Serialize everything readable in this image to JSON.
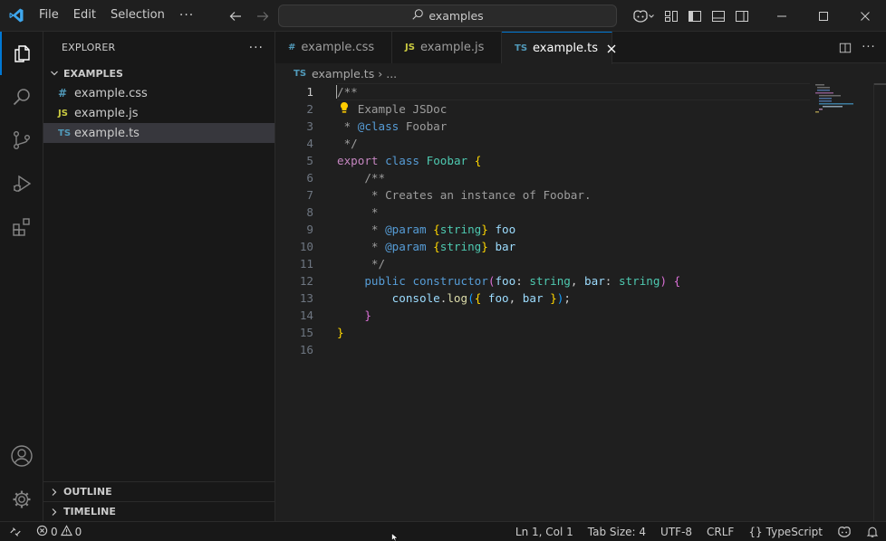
{
  "titlebar": {
    "menus": [
      "File",
      "Edit",
      "Selection"
    ],
    "more": "···",
    "search_text": "examples"
  },
  "sidebar": {
    "title": "EXPLORER",
    "more": "···",
    "folder": "EXAMPLES",
    "files": [
      {
        "name": "example.css",
        "icon": "#",
        "selected": false
      },
      {
        "name": "example.js",
        "icon": "JS",
        "selected": false
      },
      {
        "name": "example.ts",
        "icon": "TS",
        "selected": true
      }
    ],
    "outline": "OUTLINE",
    "timeline": "TIMELINE"
  },
  "tabs": [
    {
      "label": "example.css",
      "icon": "#",
      "active": false
    },
    {
      "label": "example.js",
      "icon": "JS",
      "active": false
    },
    {
      "label": "example.ts",
      "icon": "TS",
      "active": true
    }
  ],
  "breadcrumb": {
    "icon": "TS",
    "file": "example.ts",
    "sep": "›",
    "rest": "..."
  },
  "code": {
    "line_numbers": [
      "1",
      "2",
      "3",
      "4",
      "5",
      "6",
      "7",
      "8",
      "9",
      "10",
      "11",
      "12",
      "13",
      "14",
      "15",
      "16"
    ],
    "lines": [
      "/**",
      "   Example JSDoc",
      " * @class Foobar",
      " */",
      "export class Foobar {",
      "    /**",
      "     * Creates an instance of Foobar.",
      "     *",
      "     * @param {string} foo",
      "     * @param {string} bar",
      "     */",
      "    public constructor(foo: string, bar: string) {",
      "        console.log({ foo, bar });",
      "    }",
      "}",
      ""
    ]
  },
  "statusbar": {
    "errors": "0",
    "warnings": "0",
    "position": "Ln 1, Col 1",
    "tab_size": "Tab Size: 4",
    "encoding": "UTF-8",
    "eol": "CRLF",
    "language_icon": "{}",
    "language": "TypeScript"
  },
  "colors": {
    "accent": "#0078d4",
    "background": "#1f1f1f",
    "sidebar": "#181818"
  }
}
